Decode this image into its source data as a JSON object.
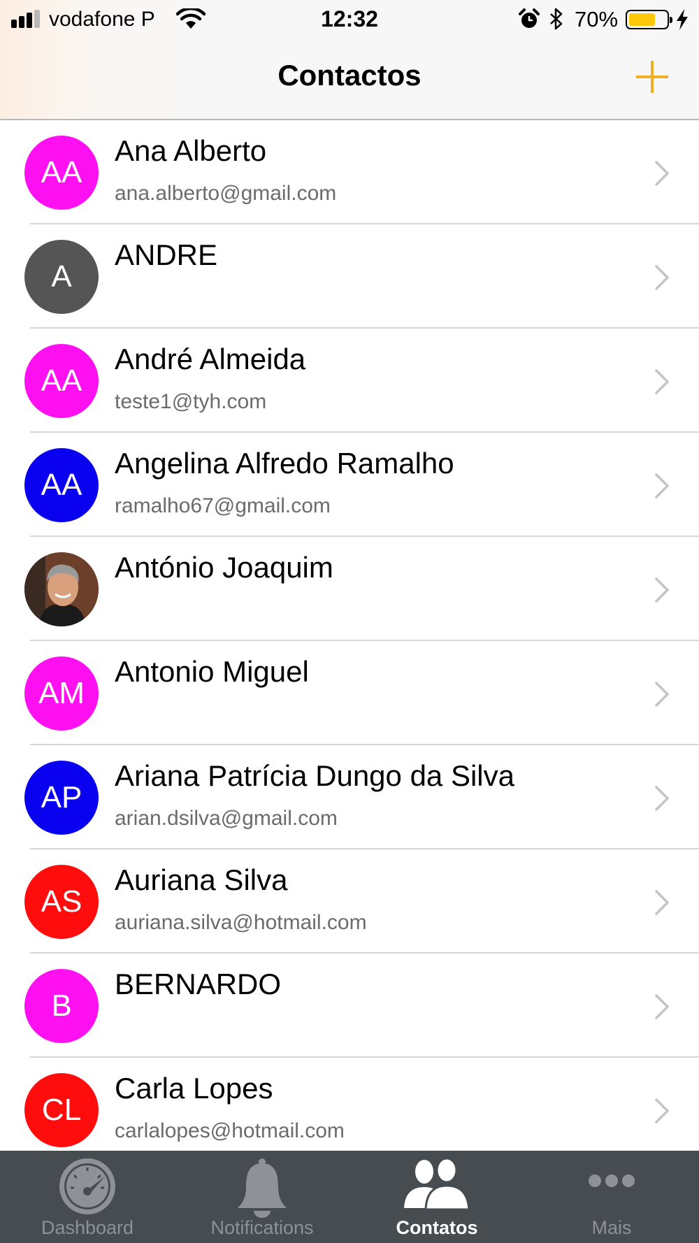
{
  "status_bar": {
    "carrier": "vodafone P",
    "time": "12:32",
    "battery_percent": "70%",
    "battery_level": 0.7,
    "icons": [
      "signal-icon",
      "wifi-icon",
      "alarm-icon",
      "bluetooth-icon",
      "battery-icon",
      "charging-icon"
    ]
  },
  "header": {
    "title": "Contactos",
    "add_icon": "plus-icon"
  },
  "contacts": [
    {
      "initials": "AA",
      "name": "Ana Alberto",
      "email": "ana.alberto@gmail.com",
      "color": "#ff10f0",
      "photo": false
    },
    {
      "initials": "A",
      "name": "ANDRE",
      "email": "",
      "color": "#555555",
      "photo": false
    },
    {
      "initials": "AA",
      "name": "André Almeida",
      "email": "teste1@tyh.com",
      "color": "#ff10f0",
      "photo": false
    },
    {
      "initials": "AA",
      "name": "Angelina Alfredo Ramalho",
      "email": "ramalho67@gmail.com",
      "color": "#0a00f0",
      "photo": false
    },
    {
      "initials": "",
      "name": "António Joaquim",
      "email": "",
      "color": "#7a4a32",
      "photo": true
    },
    {
      "initials": "AM",
      "name": "Antonio Miguel",
      "email": "",
      "color": "#ff10f0",
      "photo": false
    },
    {
      "initials": "AP",
      "name": "Ariana Patrícia Dungo da Silva",
      "email": "arian.dsilva@gmail.com",
      "color": "#0a00f0",
      "photo": false
    },
    {
      "initials": "AS",
      "name": "Auriana Silva",
      "email": "auriana.silva@hotmail.com",
      "color": "#ff0d0d",
      "photo": false
    },
    {
      "initials": "B",
      "name": "BERNARDO",
      "email": "",
      "color": "#ff10f0",
      "photo": false
    },
    {
      "initials": "CL",
      "name": "Carla Lopes",
      "email": "carlalopes@hotmail.com",
      "color": "#ff0d0d",
      "photo": false
    }
  ],
  "tabs": [
    {
      "label": "Dashboard",
      "icon": "speedometer-icon",
      "active": false
    },
    {
      "label": "Notifications",
      "icon": "bell-icon",
      "active": false
    },
    {
      "label": "Contatos",
      "icon": "people-icon",
      "active": true
    },
    {
      "label": "Mais",
      "icon": "more-dots-icon",
      "active": false
    }
  ],
  "colors": {
    "accent": "#f0b022",
    "tab_bar": "#474c50",
    "tab_inactive": "#8e9296",
    "tab_active": "#ffffff"
  }
}
